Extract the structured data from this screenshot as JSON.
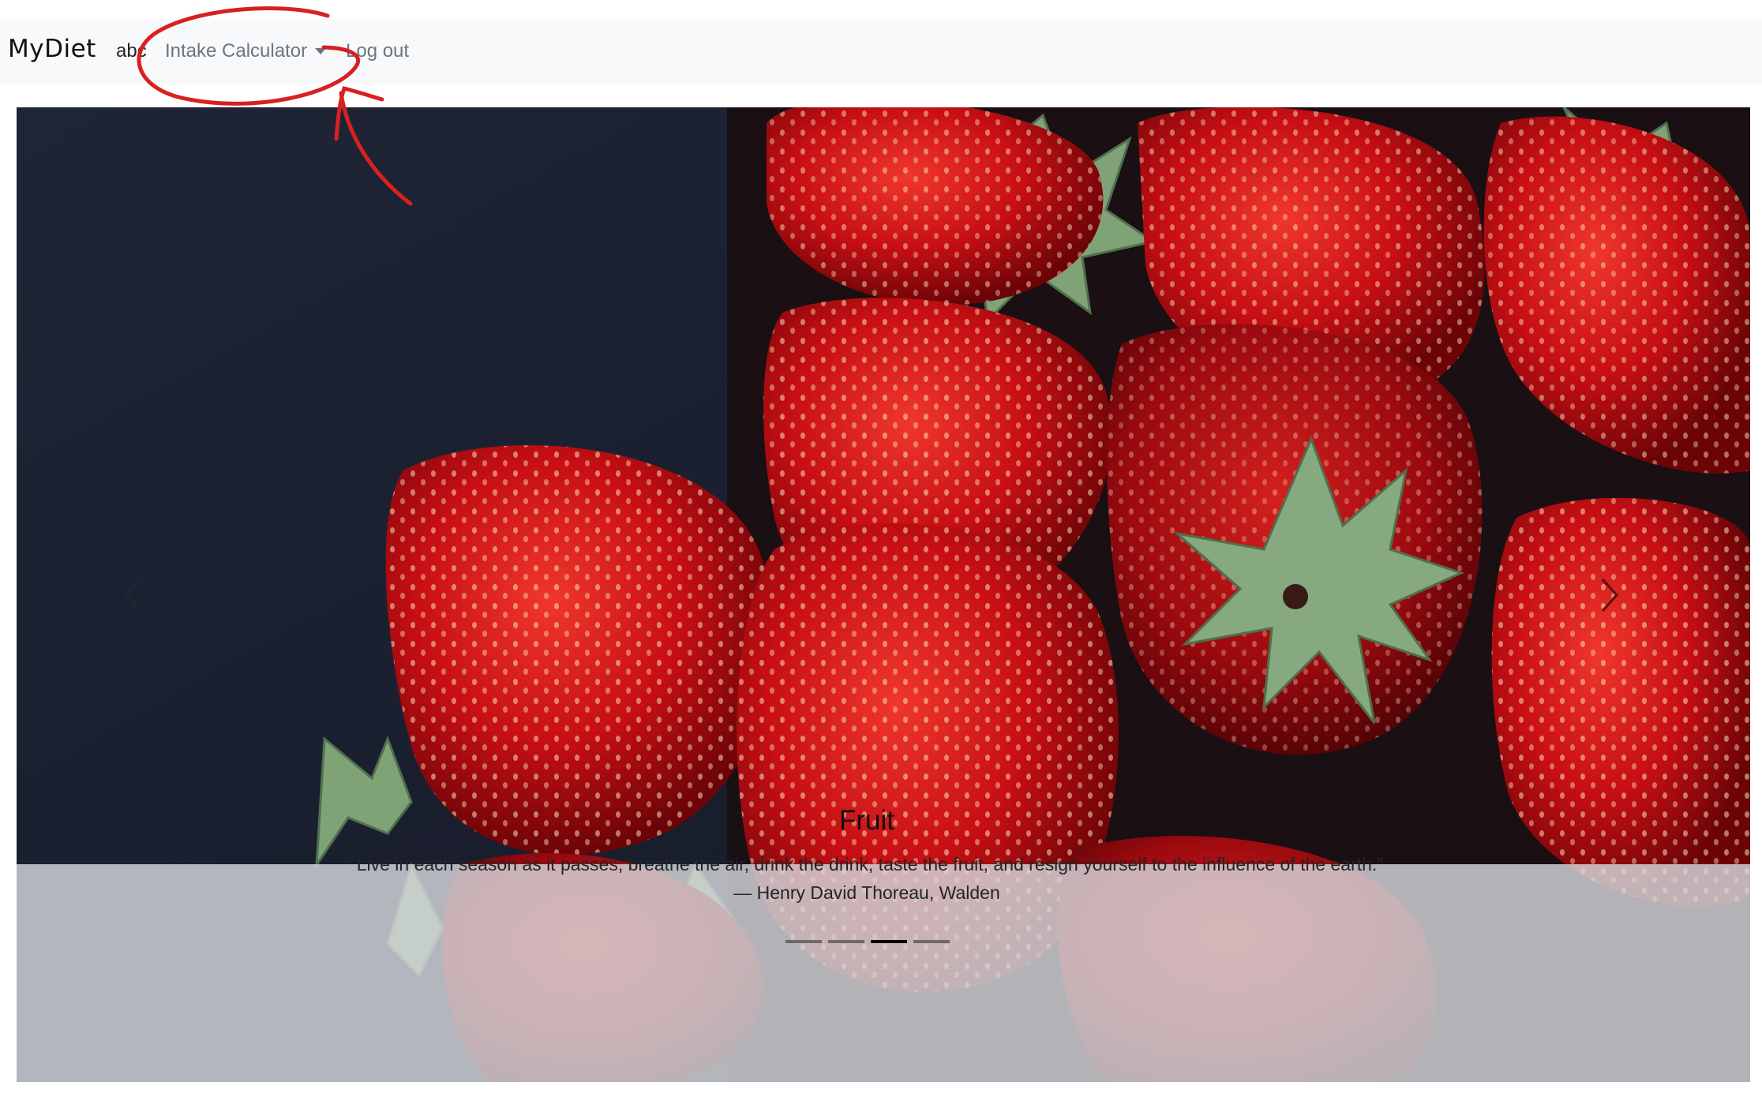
{
  "navbar": {
    "brand": "MyDiet",
    "user_label": "abc",
    "intake_label": "Intake Calculator",
    "logout_label": "Log out"
  },
  "carousel": {
    "caption_title": "Fruit",
    "caption_quote": "“Live in each season as it passes; breathe the air, drink the drink, taste the fruit, and resign yourself to the influence of the earth.”",
    "caption_author": "— Henry David Thoreau, Walden",
    "slide_count": 4,
    "active_slide": 3
  },
  "colors": {
    "navbar_bg": "#f8f9fa",
    "link": "#6c757d",
    "annotation": "#d92020"
  },
  "icons": {
    "prev": "chevron-left-icon",
    "next": "chevron-right-icon",
    "dropdown": "caret-down-icon"
  }
}
